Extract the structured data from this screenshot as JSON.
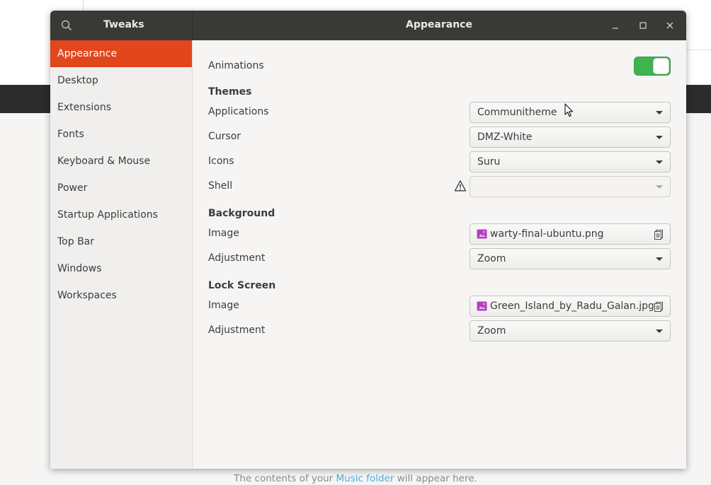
{
  "window": {
    "sidebar_title": "Tweaks",
    "title": "Appearance"
  },
  "sidebar": {
    "items": [
      {
        "label": "Appearance",
        "active": true
      },
      {
        "label": "Desktop"
      },
      {
        "label": "Extensions"
      },
      {
        "label": "Fonts"
      },
      {
        "label": "Keyboard & Mouse"
      },
      {
        "label": "Power"
      },
      {
        "label": "Startup Applications"
      },
      {
        "label": "Top Bar"
      },
      {
        "label": "Windows"
      },
      {
        "label": "Workspaces"
      }
    ]
  },
  "appearance": {
    "animations": {
      "label": "Animations",
      "enabled": true
    },
    "themes": {
      "heading": "Themes",
      "applications": {
        "label": "Applications",
        "value": "Communitheme"
      },
      "cursor": {
        "label": "Cursor",
        "value": "DMZ-White"
      },
      "icons": {
        "label": "Icons",
        "value": "Suru"
      },
      "shell": {
        "label": "Shell",
        "value": ""
      }
    },
    "background": {
      "heading": "Background",
      "image": {
        "label": "Image",
        "value": "warty-final-ubuntu.png"
      },
      "adjustment": {
        "label": "Adjustment",
        "value": "Zoom"
      }
    },
    "lock_screen": {
      "heading": "Lock Screen",
      "image": {
        "label": "Image",
        "value": "Green_Island_by_Radu_Galan.jpg"
      },
      "adjustment": {
        "label": "Adjustment",
        "value": "Zoom"
      }
    }
  },
  "background_app": {
    "status_prefix": "The contents of your ",
    "status_link": "Music folder",
    "status_suffix": " will appear here."
  },
  "colors": {
    "accent": "#e2461d",
    "toggle_on": "#3eb34f",
    "titlebar": "#393936"
  }
}
